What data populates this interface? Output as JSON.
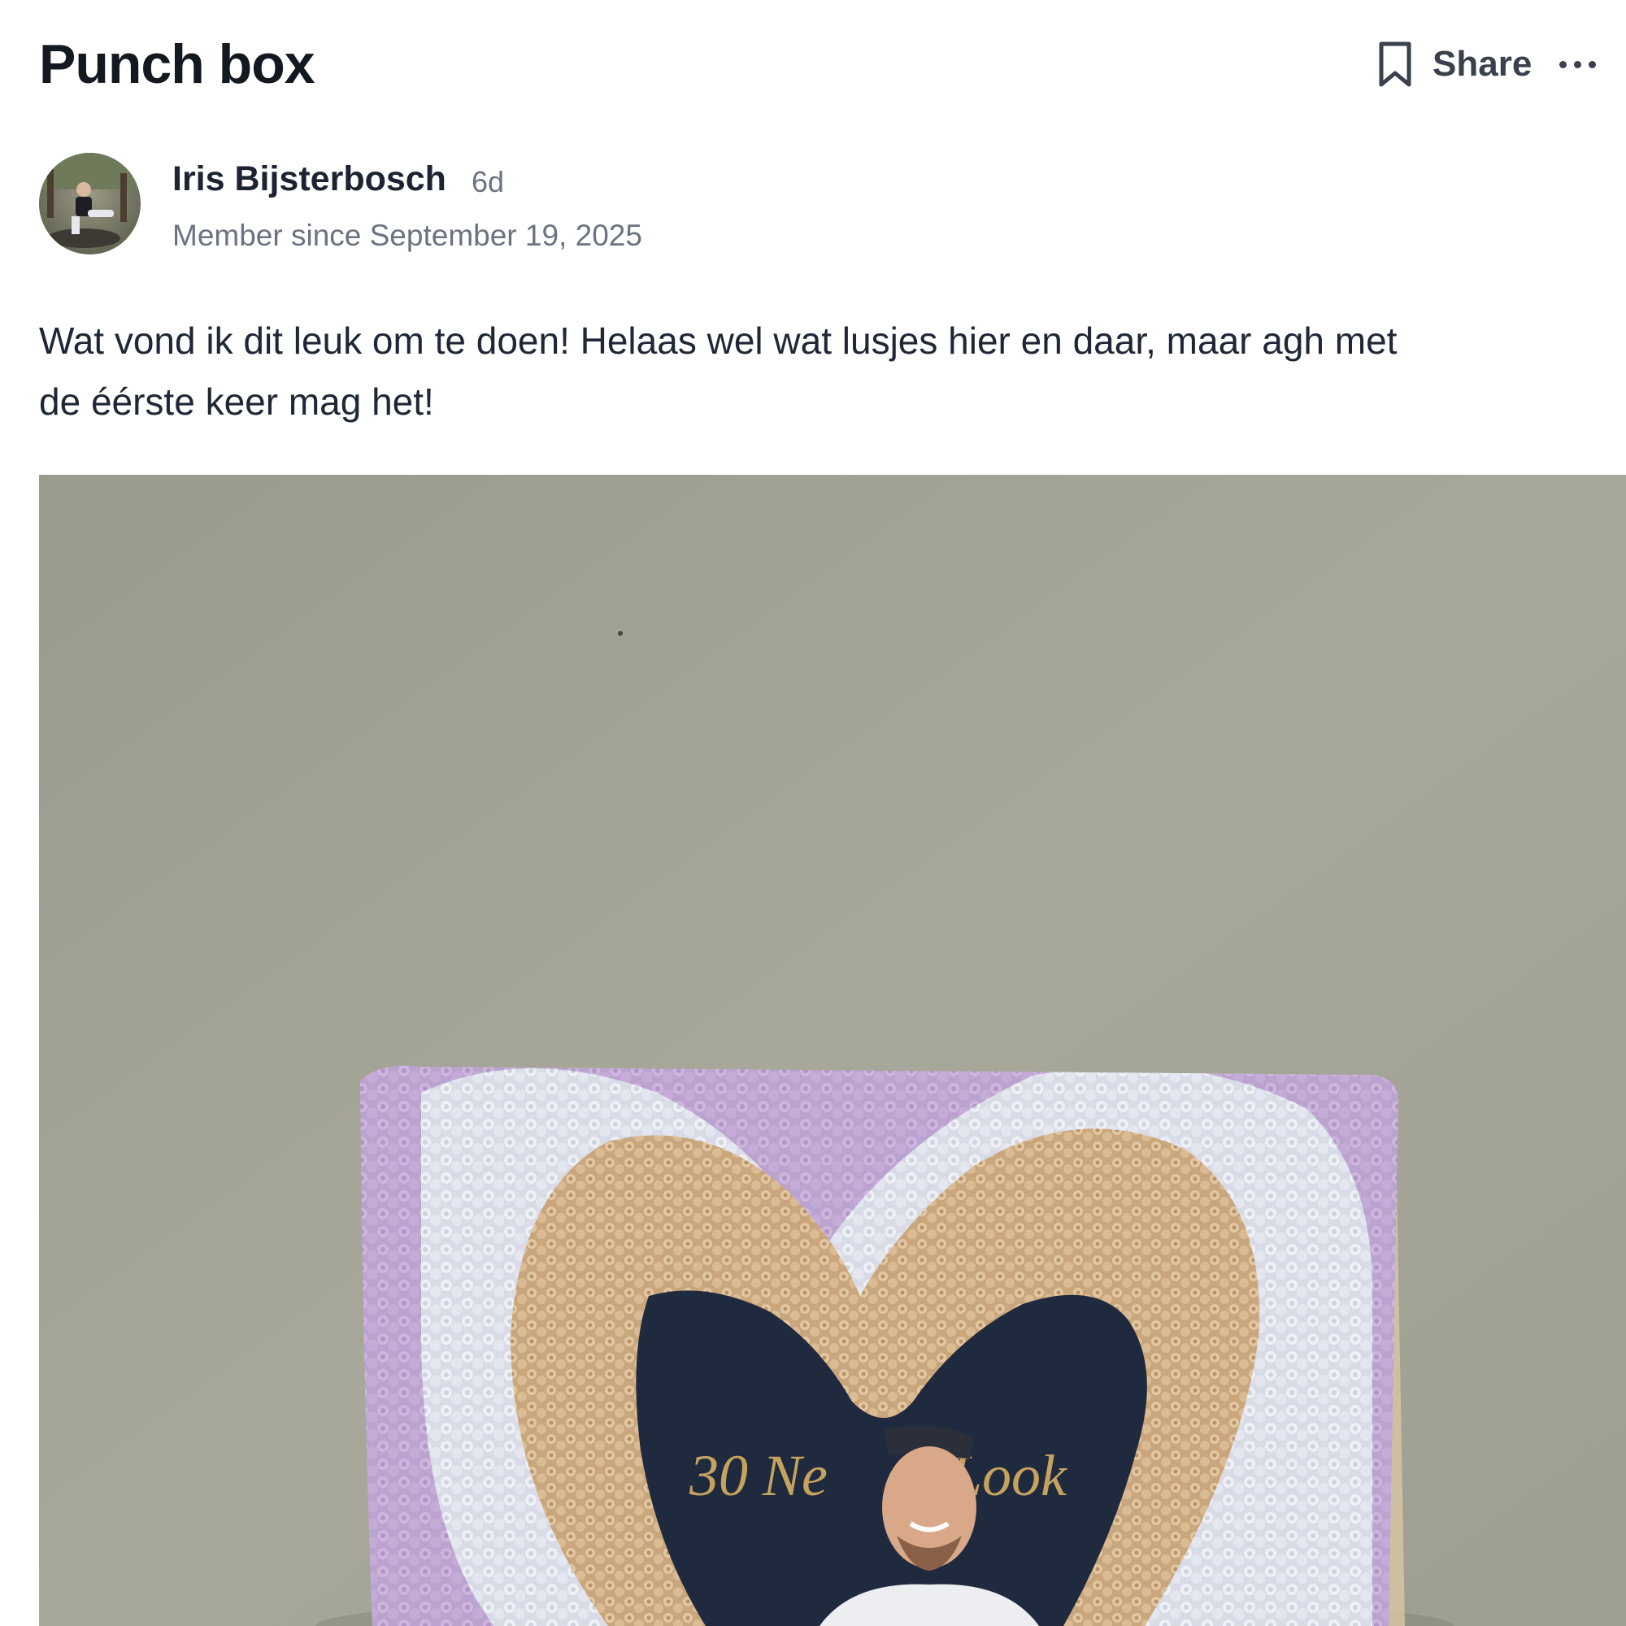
{
  "post": {
    "title": "Punch box",
    "actions": {
      "share_label": "Share"
    },
    "author": {
      "name": "Iris Bijsterbosch",
      "age": "6d",
      "member_since": "Member since September 19, 2025"
    },
    "body_line1": "Wat vond ik dit leuk om te doen! Helaas wel wat lusjes hier en daar, maar agh met",
    "body_line2": "de éérste keer mag het!",
    "image": {
      "caption_text": "30 Ne     Look"
    }
  },
  "icons": {
    "bookmark": "bookmark-icon",
    "more": "more-horizontal-icon"
  },
  "colors": {
    "wall": "#a9aa9b",
    "lilac": "#c4aed6",
    "white_yarn": "#e6e8ef",
    "beige_yarn": "#ddc09c",
    "photo_bg": "#1f2a3f",
    "text_dark": "#1f2736",
    "text_muted": "#6b7280"
  }
}
